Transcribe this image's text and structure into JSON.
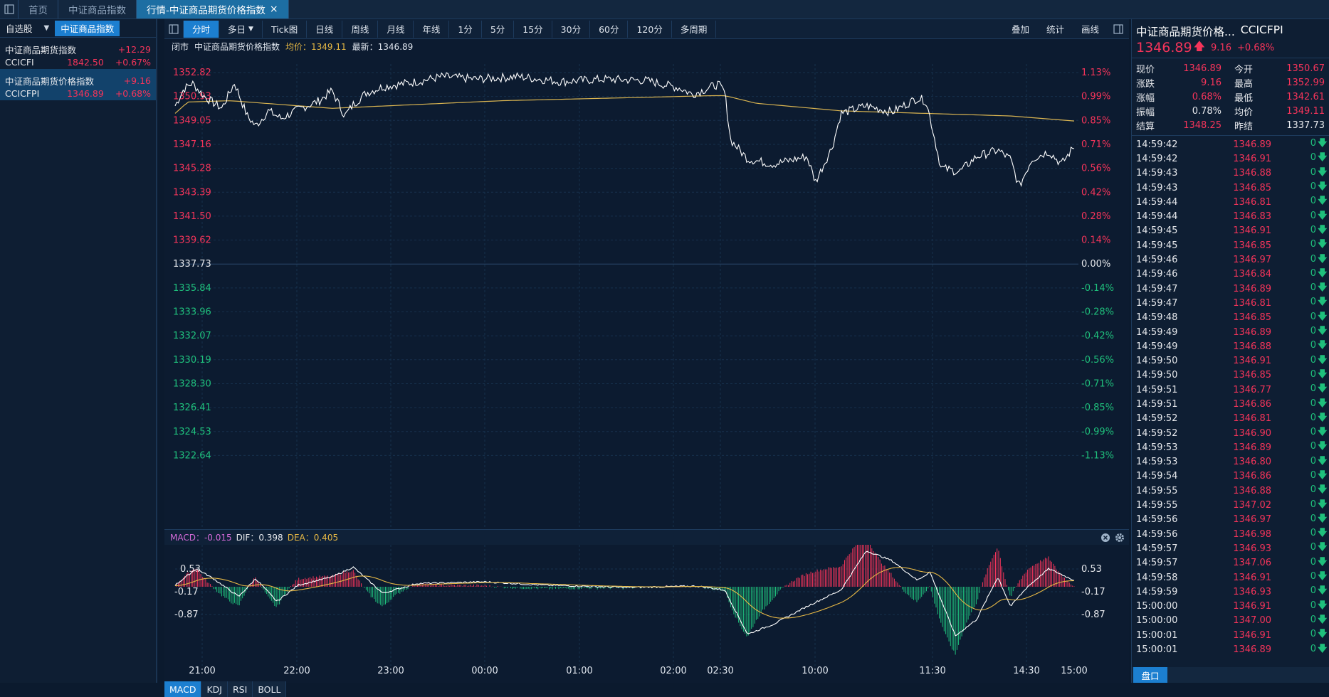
{
  "tabs": [
    {
      "label": "首页",
      "active": false
    },
    {
      "label": "中证商品指数",
      "active": false
    },
    {
      "label": "行情-中证商品期货价格指数",
      "active": true
    }
  ],
  "close_glyph": "×",
  "watchlist": {
    "tabs": [
      {
        "label": "自选股"
      },
      {
        "label": "中证商品指数"
      }
    ],
    "items": [
      {
        "name": "中证商品期货指数",
        "change": "+12.29",
        "code": "CCICFI",
        "price": "1842.50",
        "pct": "+0.67%"
      },
      {
        "name": "中证商品期货价格指数",
        "change": "+9.16",
        "code": "CCICFPI",
        "price": "1346.89",
        "pct": "+0.68%"
      }
    ]
  },
  "toolbar": {
    "periods": [
      "分时",
      "多日",
      "Tick图",
      "日线",
      "周线",
      "月线",
      "年线",
      "1分",
      "5分",
      "15分",
      "30分",
      "60分",
      "120分",
      "多周期"
    ],
    "right": [
      "叠加",
      "统计",
      "画线"
    ]
  },
  "infobar": {
    "status": "闭市",
    "name": "中证商品期货价格指数",
    "avg": "均价：1349.11",
    "last": "最新：1346.89"
  },
  "axis": {
    "left": [
      "1352.82",
      "1350.93",
      "1349.05",
      "1347.16",
      "1345.28",
      "1343.39",
      "1341.50",
      "1339.62",
      "1337.73",
      "1335.84",
      "1333.96",
      "1332.07",
      "1330.19",
      "1328.30",
      "1326.41",
      "1324.53",
      "1322.64"
    ],
    "right": [
      "1.13%",
      "0.99%",
      "0.85%",
      "0.71%",
      "0.56%",
      "0.42%",
      "0.28%",
      "0.14%",
      "0.00%",
      "-0.14%",
      "-0.28%",
      "-0.42%",
      "-0.56%",
      "-0.71%",
      "-0.85%",
      "-0.99%",
      "-1.13%"
    ],
    "macd_left": [
      "0.53",
      "-0.17",
      "-0.87"
    ],
    "macd_right": [
      "0.53",
      "-0.17",
      "-0.87"
    ],
    "x": [
      "21:00",
      "22:00",
      "23:00",
      "00:00",
      "01:00",
      "02:00",
      "02:30",
      "10:00",
      "11:30",
      "14:30",
      "15:00"
    ]
  },
  "macd": {
    "macd": "MACD：-0.015",
    "dif": "DIF：0.398",
    "dea": "DEA：0.405"
  },
  "indicators": [
    "MACD",
    "KDJ",
    "RSI",
    "BOLL"
  ],
  "quote": {
    "name": "中证商品期货价格...",
    "code": "CCICFPI",
    "price": "1346.89",
    "change": "9.16",
    "pct": "+0.68%",
    "stats": [
      {
        "k": "现价",
        "v": "1346.89",
        "c": "up",
        "k2": "今开",
        "v2": "1350.67",
        "c2": "up"
      },
      {
        "k": "涨跌",
        "v": "9.16",
        "c": "up",
        "k2": "最高",
        "v2": "1352.99",
        "c2": "up"
      },
      {
        "k": "涨幅",
        "v": "0.68%",
        "c": "up",
        "k2": "最低",
        "v2": "1342.61",
        "c2": "up"
      },
      {
        "k": "振幅",
        "v": "0.78%",
        "c": "wh",
        "k2": "均价",
        "v2": "1349.11",
        "c2": "up"
      },
      {
        "k": "结算",
        "v": "1348.25",
        "c": "up",
        "k2": "昨结",
        "v2": "1337.73",
        "c2": "wh"
      }
    ]
  },
  "ticks": [
    [
      "14:59:42",
      "1346.89"
    ],
    [
      "14:59:42",
      "1346.91"
    ],
    [
      "14:59:43",
      "1346.88"
    ],
    [
      "14:59:43",
      "1346.85"
    ],
    [
      "14:59:44",
      "1346.81"
    ],
    [
      "14:59:44",
      "1346.83"
    ],
    [
      "14:59:45",
      "1346.91"
    ],
    [
      "14:59:45",
      "1346.85"
    ],
    [
      "14:59:46",
      "1346.97"
    ],
    [
      "14:59:46",
      "1346.84"
    ],
    [
      "14:59:47",
      "1346.89"
    ],
    [
      "14:59:47",
      "1346.81"
    ],
    [
      "14:59:48",
      "1346.85"
    ],
    [
      "14:59:49",
      "1346.89"
    ],
    [
      "14:59:49",
      "1346.88"
    ],
    [
      "14:59:50",
      "1346.91"
    ],
    [
      "14:59:50",
      "1346.85"
    ],
    [
      "14:59:51",
      "1346.77"
    ],
    [
      "14:59:51",
      "1346.86"
    ],
    [
      "14:59:52",
      "1346.81"
    ],
    [
      "14:59:52",
      "1346.90"
    ],
    [
      "14:59:53",
      "1346.89"
    ],
    [
      "14:59:53",
      "1346.80"
    ],
    [
      "14:59:54",
      "1346.86"
    ],
    [
      "14:59:55",
      "1346.88"
    ],
    [
      "14:59:55",
      "1347.02"
    ],
    [
      "14:59:56",
      "1346.97"
    ],
    [
      "14:59:56",
      "1346.98"
    ],
    [
      "14:59:57",
      "1346.93"
    ],
    [
      "14:59:57",
      "1347.06"
    ],
    [
      "14:59:58",
      "1346.91"
    ],
    [
      "14:59:59",
      "1346.93"
    ],
    [
      "15:00:00",
      "1346.91"
    ],
    [
      "15:00:00",
      "1347.00"
    ],
    [
      "15:00:01",
      "1346.91"
    ],
    [
      "15:00:01",
      "1346.89"
    ]
  ],
  "tick_volume": "0",
  "pankou": "盘口",
  "colors": {
    "up": "#f5345a",
    "down": "#1fc07c",
    "price_line": "#ffffff",
    "avg_line": "#d9b451",
    "dea_line": "#e6b845",
    "active": "#1c7fd0"
  }
}
